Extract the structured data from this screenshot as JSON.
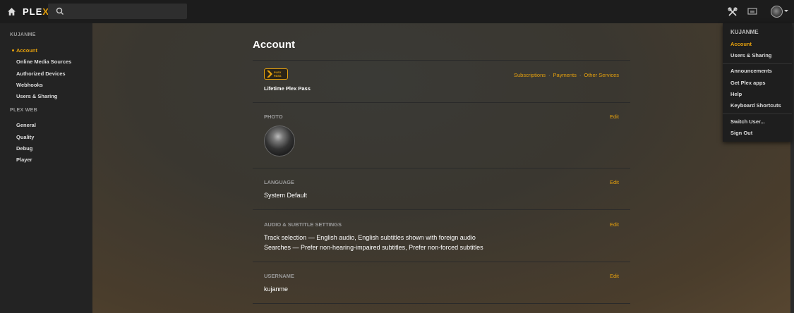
{
  "topbar": {
    "logo_plex": "PLE",
    "logo_x": "X",
    "search_placeholder": ""
  },
  "sidebar": {
    "heading_user": "KUJANME",
    "items_user": [
      {
        "label": "Account",
        "active": true
      },
      {
        "label": "Online Media Sources"
      },
      {
        "label": "Authorized Devices"
      },
      {
        "label": "Webhooks"
      },
      {
        "label": "Users & Sharing"
      }
    ],
    "heading_web": "PLEX WEB",
    "items_web": [
      {
        "label": "General"
      },
      {
        "label": "Quality"
      },
      {
        "label": "Debug"
      },
      {
        "label": "Player"
      }
    ]
  },
  "main": {
    "title": "Account",
    "plexpass_badge_text": "PLEX PASS",
    "plan": "Lifetime Plex Pass",
    "links": [
      "Subscriptions",
      "Payments",
      "Other Services"
    ],
    "sections": [
      {
        "label": "PHOTO",
        "edit": "Edit"
      },
      {
        "label": "LANGUAGE",
        "edit": "Edit",
        "value": "System Default"
      },
      {
        "label": "AUDIO & SUBTITLE SETTINGS",
        "edit": "Edit",
        "value_line1": "Track selection — English audio, English subtitles shown with foreign audio",
        "value_line2": "Searches — Prefer non-hearing-impaired subtitles, Prefer non-forced subtitles"
      },
      {
        "label": "USERNAME",
        "edit": "Edit",
        "value": "kujanme"
      }
    ]
  },
  "menu": {
    "heading": "KUJANME",
    "group1": [
      "Account",
      "Users & Sharing"
    ],
    "group2": [
      "Announcements",
      "Get Plex apps",
      "Help",
      "Keyboard Shortcuts"
    ],
    "group3": [
      "Switch User...",
      "Sign Out"
    ]
  },
  "colors": {
    "accent": "#e5a00d",
    "topbar_bg": "#1c1c1c",
    "sidebar_bg": "#232323"
  }
}
